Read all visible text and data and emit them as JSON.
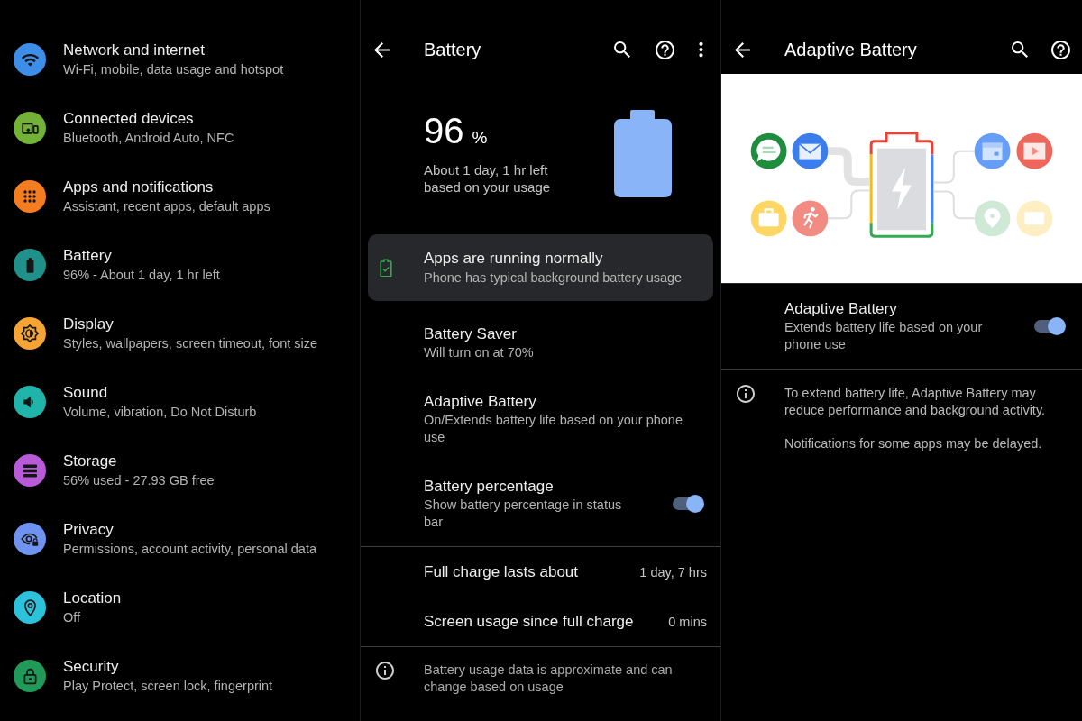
{
  "settings_list": {
    "items": [
      {
        "title": "Network and internet",
        "subtitle": "Wi-Fi, mobile, data usage and hotspot",
        "color": "#3c8ee8"
      },
      {
        "title": "Connected devices",
        "subtitle": "Bluetooth, Android Auto, NFC",
        "color": "#72b236"
      },
      {
        "title": "Apps and notifications",
        "subtitle": "Assistant, recent apps, default apps",
        "color": "#f57d20"
      },
      {
        "title": "Battery",
        "subtitle": "96% - About 1 day, 1 hr left",
        "color": "#20908a"
      },
      {
        "title": "Display",
        "subtitle": "Styles, wallpapers, screen timeout, font size",
        "color": "#f6a534"
      },
      {
        "title": "Sound",
        "subtitle": "Volume, vibration, Do Not Disturb",
        "color": "#20b4aa"
      },
      {
        "title": "Storage",
        "subtitle": "56% used - 27.93 GB free",
        "color": "#b95ad9"
      },
      {
        "title": "Privacy",
        "subtitle": "Permissions, account activity, personal data",
        "color": "#6e93f0"
      },
      {
        "title": "Location",
        "subtitle": "Off",
        "color": "#2cc2dc"
      },
      {
        "title": "Security",
        "subtitle": "Play Protect, screen lock, fingerprint",
        "color": "#1f9a58"
      }
    ]
  },
  "battery_screen": {
    "title": "Battery",
    "summary": {
      "percent": "96",
      "unit": "%",
      "estimate": "About 1 day, 1 hr left based on your usage"
    },
    "status_card": {
      "title": "Apps are running normally",
      "subtitle": "Phone has typical background battery usage"
    },
    "preferences": [
      {
        "kind": "link",
        "title": "Battery Saver",
        "subtitle": "Will turn on at 70%"
      },
      {
        "kind": "link",
        "title": "Adaptive Battery",
        "subtitle": "On/Extends battery life based on your phone use"
      },
      {
        "kind": "toggle",
        "title": "Battery percentage",
        "subtitle": "Show battery percentage in status bar",
        "on": true
      }
    ],
    "stats": [
      {
        "label": "Full charge lasts about",
        "value": "1 day, 7 hrs"
      },
      {
        "label": "Screen usage since full charge",
        "value": "0 mins"
      }
    ],
    "footnote": "Battery usage data is approximate and can change based on usage"
  },
  "adaptive_battery_screen": {
    "title": "Adaptive Battery",
    "setting": {
      "title": "Adaptive Battery",
      "subtitle": "Extends battery life based on your phone use",
      "on": true
    },
    "notes": [
      "To extend battery life, Adaptive Battery may reduce performance and background activity.",
      "Notifications for some apps may be delayed."
    ]
  }
}
